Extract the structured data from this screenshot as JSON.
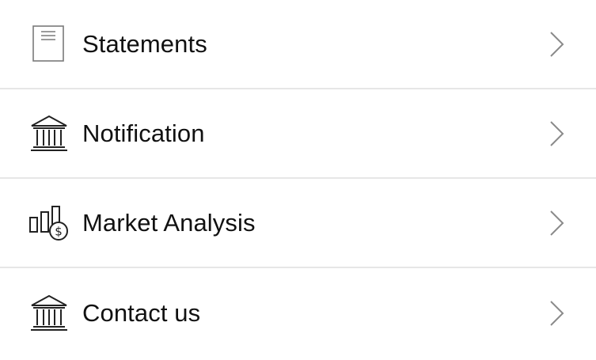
{
  "menu": {
    "items": [
      {
        "label": "Statements",
        "icon": "statement-document-icon"
      },
      {
        "label": "Notification",
        "icon": "bank-building-icon"
      },
      {
        "label": "Market Analysis",
        "icon": "chart-dollar-icon"
      },
      {
        "label": "Contact us",
        "icon": "bank-building-icon"
      }
    ]
  },
  "colors": {
    "text": "#111111",
    "divider": "#e6e6e6",
    "icon": "#333333",
    "chevron": "#8a8a8a"
  }
}
